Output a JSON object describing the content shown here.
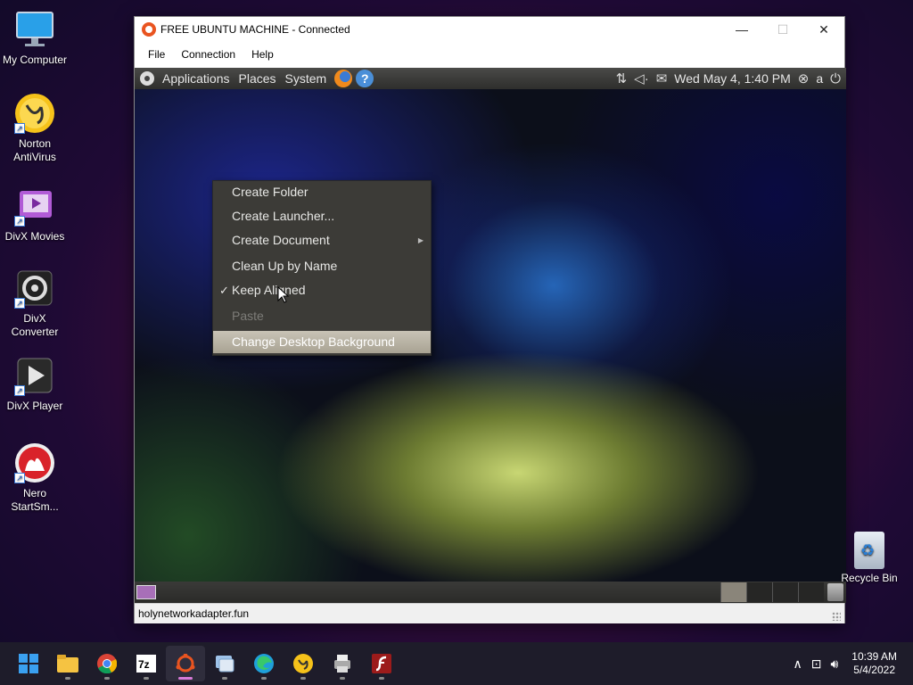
{
  "desktop": {
    "icons": [
      {
        "label": "My Computer",
        "icon": "monitor-icon"
      },
      {
        "label": "Norton AntiVirus",
        "icon": "norton-icon"
      },
      {
        "label": "DivX Movies",
        "icon": "divx-movies-icon"
      },
      {
        "label": "DivX Converter",
        "icon": "divx-converter-icon"
      },
      {
        "label": "DivX Player",
        "icon": "divx-player-icon"
      },
      {
        "label": "Nero StartSm...",
        "icon": "nero-icon"
      }
    ],
    "recycle_bin": "Recycle Bin"
  },
  "window": {
    "title": "FREE UBUNTU MACHINE - Connected",
    "controls": {
      "minimize": "—",
      "maximize": "☐",
      "close": "✕"
    },
    "menu": [
      "File",
      "Connection",
      "Help"
    ],
    "status": "holynetworkadapter.fun"
  },
  "ubuntu": {
    "top_panel": {
      "menus": [
        "Applications",
        "Places",
        "System"
      ],
      "datetime": "Wed May  4,  1:40 PM",
      "user_initial": "a"
    },
    "context_menu": [
      {
        "label": "Create Folder",
        "state": "normal"
      },
      {
        "label": "Create Launcher...",
        "state": "normal"
      },
      {
        "label": "Create Document",
        "state": "submenu"
      },
      {
        "label": "Clean Up by Name",
        "state": "normal"
      },
      {
        "label": "Keep Aligned",
        "state": "checked"
      },
      {
        "label": "Paste",
        "state": "disabled"
      },
      {
        "label": "Change Desktop Background",
        "state": "hover"
      }
    ]
  },
  "taskbar": {
    "apps": [
      "windows-start-icon",
      "file-explorer-icon",
      "chrome-icon",
      "7zip-icon",
      "ubuntu-remote-icon",
      "network-folder-icon",
      "edge-icon",
      "norton-icon",
      "printer-app-icon",
      "flash-icon"
    ],
    "clock": {
      "time": "10:39 AM",
      "date": "5/4/2022"
    }
  },
  "colors": {
    "ubuntu_orange": "#e95420",
    "menu_bg": "#3c3b37",
    "highlight": "#b5ae9f"
  }
}
